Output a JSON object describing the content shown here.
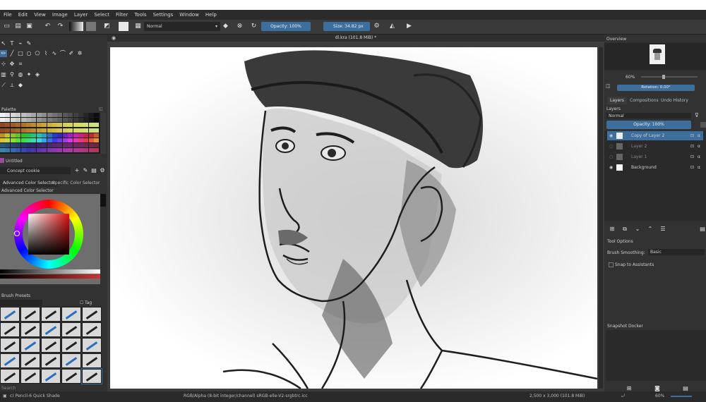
{
  "menu": [
    "File",
    "Edit",
    "View",
    "Image",
    "Layer",
    "Select",
    "Filter",
    "Tools",
    "Settings",
    "Window",
    "Help"
  ],
  "toolbar": {
    "blend_mode": "Normal",
    "opacity": "Opacity: 100%",
    "size": "Size: 34.82 px"
  },
  "document": {
    "tab_title": "dl.kra (101.8 MiB) *"
  },
  "left_panel": {
    "palette_title": "Palette",
    "palette_name": "Untitled",
    "concept_label": "Concept cookie",
    "tabs": [
      "Advanced Color Selector",
      "Specific Color Selector"
    ],
    "selector_title": "Advanced Color Selector",
    "brush_presets_title": "Brush Presets",
    "tag_label": "Tag",
    "search_placeholder": "Search"
  },
  "right_panel": {
    "overview_title": "Overview",
    "zoom": "60%",
    "rotation": "Rotation: 0.00°",
    "tabs": [
      "Layers",
      "Compositions",
      "Undo History"
    ],
    "layers_title": "Layers",
    "blend_mode": "Normal",
    "opacity": "Opacity: 100%",
    "layers": [
      {
        "name": "Copy of Layer 2",
        "selected": true
      },
      {
        "name": "Layer 2",
        "selected": false
      },
      {
        "name": "Layer 1",
        "selected": false
      },
      {
        "name": "Background",
        "selected": false
      }
    ],
    "tool_options_title": "Tool Options",
    "brush_smoothing_label": "Brush Smoothing:",
    "brush_smoothing_value": "Basic",
    "snap_label": "Snap to Assistants",
    "snapshot_title": "Snapshot Docker",
    "bottom_zoom": "60%"
  },
  "status": {
    "brush": "c) Pencil-6 Quick Shade",
    "color_info": "RGB/Alpha (8-bit integer/channel) sRGB-elle-V2-srgbtrc.icc",
    "image_info": "2,500 x 3,000 (101.8 MiB)"
  },
  "colors": {
    "accent_blue": "#3d6f9e",
    "panel_bg": "#323232",
    "canvas_bg": "#ffffff"
  }
}
